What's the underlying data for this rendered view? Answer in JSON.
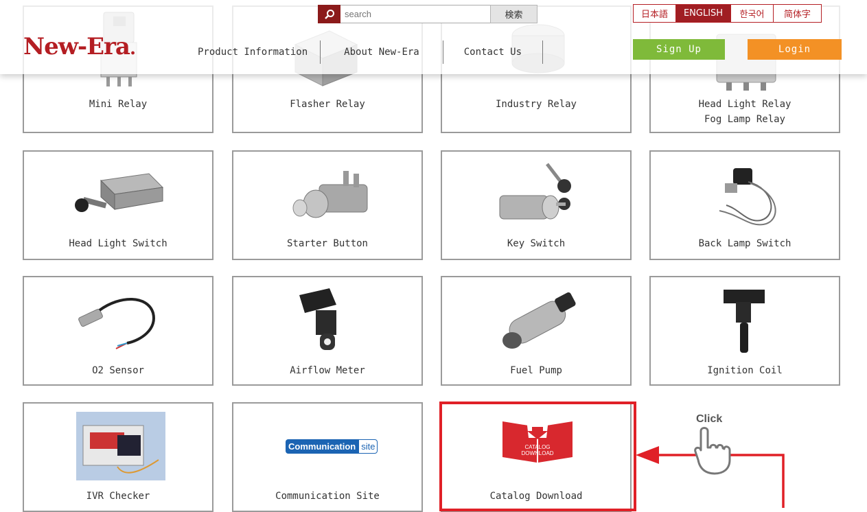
{
  "header": {
    "logo_text": "New-Era",
    "logo_dot": ".",
    "search_placeholder": "search",
    "search_button": "検索",
    "nav": [
      "Product Information",
      "About New-Era",
      "Contact Us"
    ],
    "languages": [
      "日本語",
      "ENGLISH",
      "한국어",
      "简体字"
    ],
    "active_language": "ENGLISH",
    "signup": "Sign Up",
    "login": "Login"
  },
  "products": [
    {
      "label": "Mini Relay",
      "icon": "relay-icon"
    },
    {
      "label": "Flasher Relay",
      "icon": "flasher-icon"
    },
    {
      "label": "Industry Relay",
      "icon": "industry-relay-icon"
    },
    {
      "label": "Head Light Relay",
      "label2": "Fog Lamp Relay",
      "icon": "headlight-relay-icon"
    },
    {
      "label": "Head Light Switch",
      "icon": "switch-icon"
    },
    {
      "label": "Starter Button",
      "icon": "button-icon"
    },
    {
      "label": "Key Switch",
      "icon": "key-icon"
    },
    {
      "label": "Back Lamp Switch",
      "icon": "sensor-switch-icon"
    },
    {
      "label": "O2 Sensor",
      "icon": "o2-sensor-icon"
    },
    {
      "label": "Airflow Meter",
      "icon": "airflow-icon"
    },
    {
      "label": "Fuel Pump",
      "icon": "pump-icon"
    },
    {
      "label": "Ignition Coil",
      "icon": "coil-icon"
    },
    {
      "label": "IVR Checker",
      "icon": "checker-icon"
    },
    {
      "label": "Communication Site",
      "icon": "communication-icon",
      "badge": "Communication",
      "badge2": "site"
    },
    {
      "label": "Catalog Download",
      "icon": "catalog-download-icon",
      "badge": "CATALOG",
      "badge2": "DOWNLOAD"
    }
  ],
  "annotation": {
    "click_text": "Click",
    "highlight_color": "#e02027"
  },
  "colors": {
    "brand": "#b41e23",
    "signup": "#7fba3a",
    "login": "#f39125"
  }
}
